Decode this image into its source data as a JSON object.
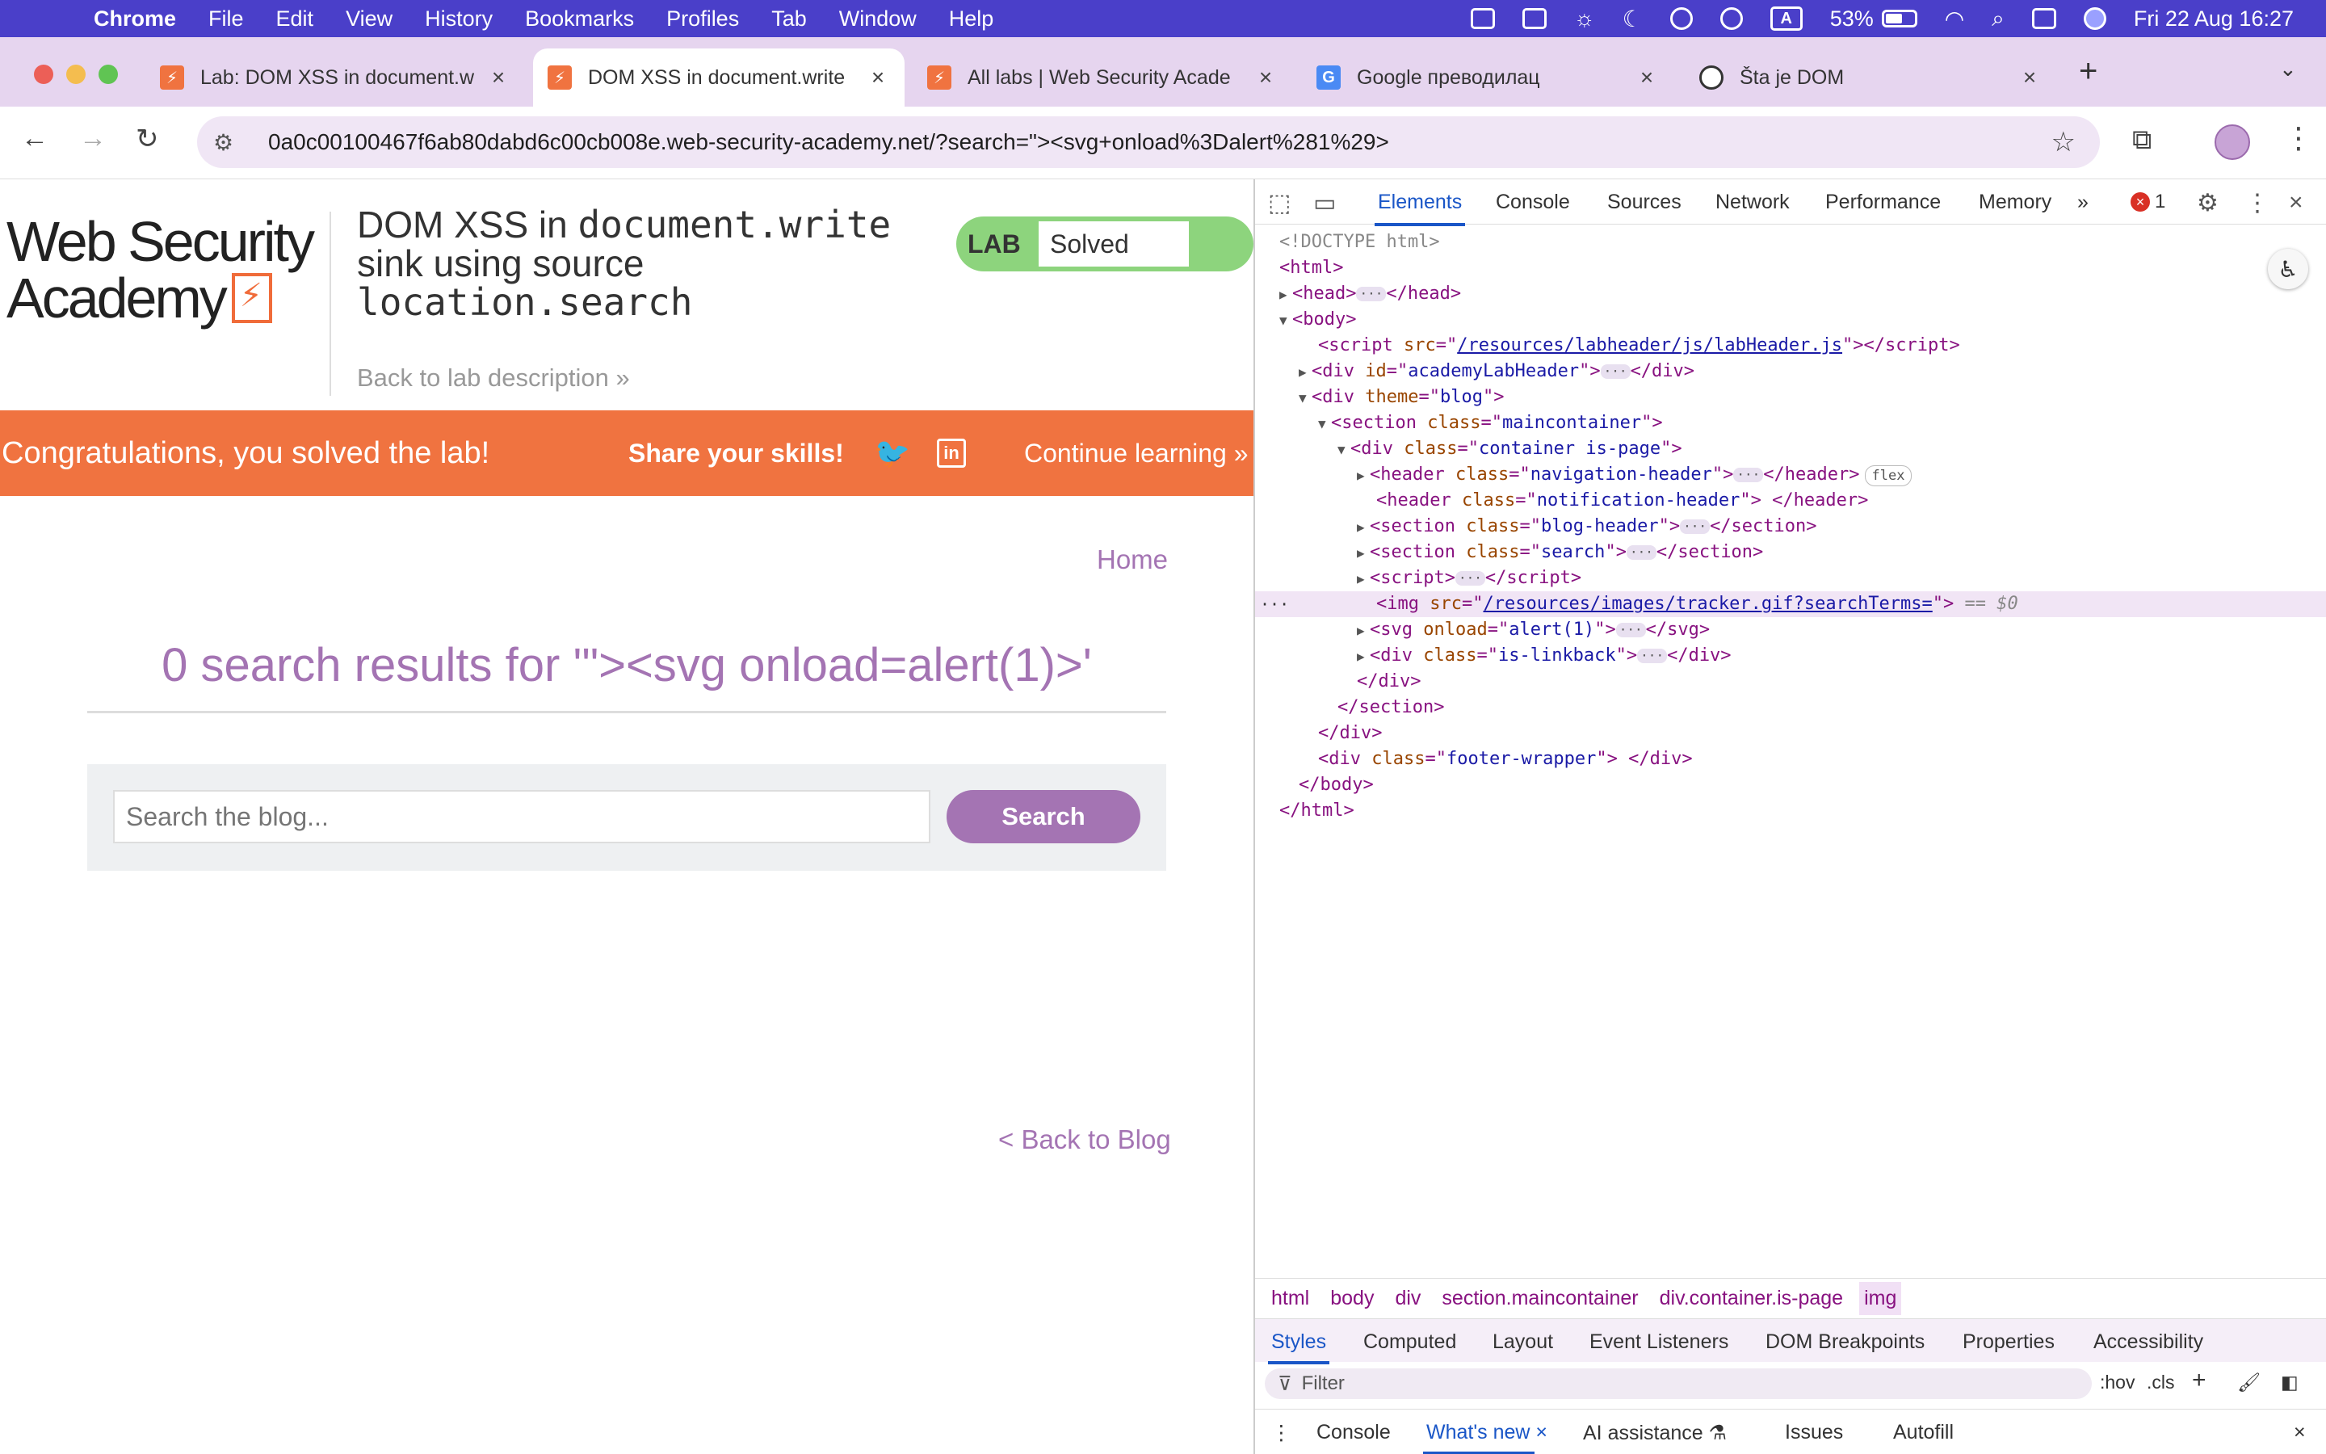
{
  "menubar": {
    "app": "Chrome",
    "items": [
      "File",
      "Edit",
      "View",
      "History",
      "Bookmarks",
      "Profiles",
      "Tab",
      "Window",
      "Help"
    ],
    "battery": "53%",
    "input_source": "A",
    "datetime": "Fri 22 Aug  16:27"
  },
  "tabs": [
    {
      "title": "Lab: DOM XSS in document.w",
      "favicon": "portswigger-icon",
      "active": false
    },
    {
      "title": "DOM XSS in document.write",
      "favicon": "portswigger-icon",
      "active": true
    },
    {
      "title": "All labs | Web Security Acade",
      "favicon": "portswigger-icon",
      "active": false
    },
    {
      "title": "Google преводилац",
      "favicon": "google-translate-icon",
      "active": false
    },
    {
      "title": "Šta je DOM",
      "favicon": "chatgpt-icon",
      "active": false
    }
  ],
  "address": {
    "url": "0a0c00100467f6ab80dabd6c00cb008e.web-security-academy.net/?search=\"><svg+onload%3Dalert%281%29>"
  },
  "page": {
    "logo_line1": "Web Security",
    "logo_line2": "Academy",
    "lab_title_1": "DOM XSS in ",
    "lab_title_code1": "document.write",
    "lab_title_2": "sink using source",
    "lab_title_code2": "location.search",
    "back_to_description": "Back to lab description",
    "lab_label": "LAB",
    "lab_status": "Solved",
    "banner_text": "Congratulations, you solved the lab!",
    "share_text": "Share your skills!",
    "continue_text": "Continue learning",
    "home_link": "Home",
    "results_heading": "0 search results for '\"><svg onload=alert(1)>'",
    "search_placeholder": "Search the blog...",
    "search_button": "Search",
    "back_to_blog": "< Back to Blog"
  },
  "devtools": {
    "tabs": [
      "Elements",
      "Console",
      "Sources",
      "Network",
      "Performance",
      "Memory"
    ],
    "active_tab": "Elements",
    "error_count": "1",
    "dom": {
      "doctype": "<!DOCTYPE html>",
      "script_src": "/resources/labheader/js/labHeader.js",
      "header_id": "academyLabHeader",
      "div_theme": "blog",
      "section_class": "maincontainer",
      "container_class": "container is-page",
      "nav_header_class": "navigation-header",
      "notif_header_class": "notification-header",
      "blog_header_class": "blog-header",
      "search_class": "search",
      "img_src": "/resources/images/tracker.gif?searchTerms=",
      "svg_onload": "alert(1)",
      "linkback_class": "is-linkback",
      "footer_class": "footer-wrapper",
      "flex_badge": "flex",
      "eq": "== $0"
    },
    "breadcrumbs": [
      "html",
      "body",
      "div",
      "section.maincontainer",
      "div.container.is-page",
      "img"
    ],
    "sub_tabs": [
      "Styles",
      "Computed",
      "Layout",
      "Event Listeners",
      "DOM Breakpoints",
      "Properties",
      "Accessibility"
    ],
    "filter_placeholder": "Filter",
    "filter_hov": ":hov",
    "filter_cls": ".cls",
    "drawer_tabs": [
      "Console",
      "What's new",
      "AI assistance",
      "Issues",
      "Autofill"
    ]
  },
  "colors": {
    "menubar": "#4a3fc9",
    "tabbar": "#e6d5ef",
    "banner": "#f07340",
    "accent": "#a474b3",
    "lab_solved": "#8dd47d"
  }
}
